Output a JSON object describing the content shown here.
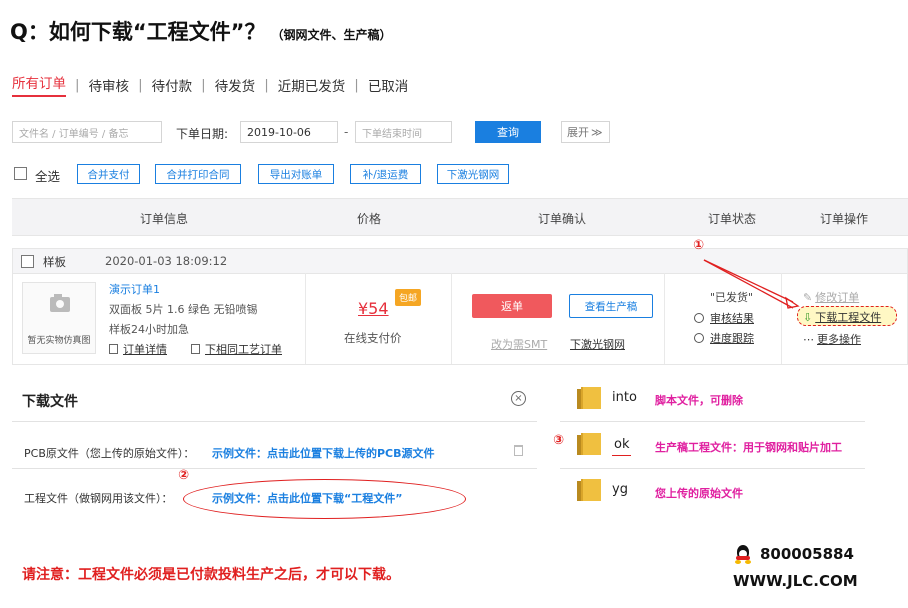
{
  "heading": {
    "title": "Q：如何下载“工程文件”？",
    "subtitle": "（钢网文件、生产稿）"
  },
  "tabs": [
    {
      "label": "所有订单",
      "active": true
    },
    {
      "label": "待审核",
      "active": false
    },
    {
      "label": "待付款",
      "active": false
    },
    {
      "label": "待发货",
      "active": false
    },
    {
      "label": "近期已发货",
      "active": false
    },
    {
      "label": "已取消",
      "active": false
    }
  ],
  "filters": {
    "search_placeholder": "文件名 / 订单编号 / 备忘",
    "date_label": "下单日期:",
    "start_date": "2019-10-06",
    "dash": "-",
    "end_placeholder": "下单结束时间",
    "query_button": "查询",
    "expand": "展开"
  },
  "actions": {
    "select_all": "全选",
    "buttons": [
      "合并支付",
      "合并打印合同",
      "导出对账单",
      "补/退运费",
      "下激光钢网"
    ]
  },
  "table_headers": [
    "订单信息",
    "价格",
    "订单确认",
    "订单状态",
    "订单操作"
  ],
  "order": {
    "type": "样板",
    "time": "2020-01-03 18:09:12",
    "thumb_caption": "暂无实物仿真图",
    "name": "演示订单1",
    "spec": "双面板  5片  1.6  绿色  无铅喷锡",
    "urgent": "样板24小时加急",
    "detail_link": "订单详情",
    "same_process_link": "下相同工艺订单",
    "price": "¥54",
    "badge": "包邮",
    "pay_method": "在线支付价",
    "return_button": "返单",
    "view_draft_button": "查看生产稿",
    "change_smt": "改为需SMT",
    "laser_stencil": "下激光钢网",
    "status": "\"已发货\"",
    "review_result": "审核结果",
    "progress": "进度跟踪",
    "edit_order": "修改订单",
    "download_eng": "下载工程文件",
    "more_ops": "更多操作"
  },
  "download_panel": {
    "title": "下载文件",
    "pcb_label": "PCB原文件（您上传的原始文件）：",
    "pcb_link": "示例文件：点击此位置下载上传的PCB源文件",
    "eng_label": "工程文件（做钢网用该文件）：",
    "eng_link": "示例文件：点击此位置下载“工程文件”"
  },
  "folders": [
    {
      "name": "into",
      "note": "脚本文件，可删除"
    },
    {
      "name": "ok",
      "note": "生产稿工程文件：用于钢网和贴片加工"
    },
    {
      "name": "yg",
      "note": "您上传的原始文件"
    }
  ],
  "markers": [
    "①",
    "②",
    "③"
  ],
  "notice": "请注意：工程文件必须是已付款投料生产之后，才可以下载。",
  "contact": {
    "qq": "800005884",
    "site": "WWW.JLC.COM"
  },
  "colors": {
    "accent_red": "#e6303c",
    "link_blue": "#1a7fe0",
    "note_magenta": "#e020a0"
  }
}
